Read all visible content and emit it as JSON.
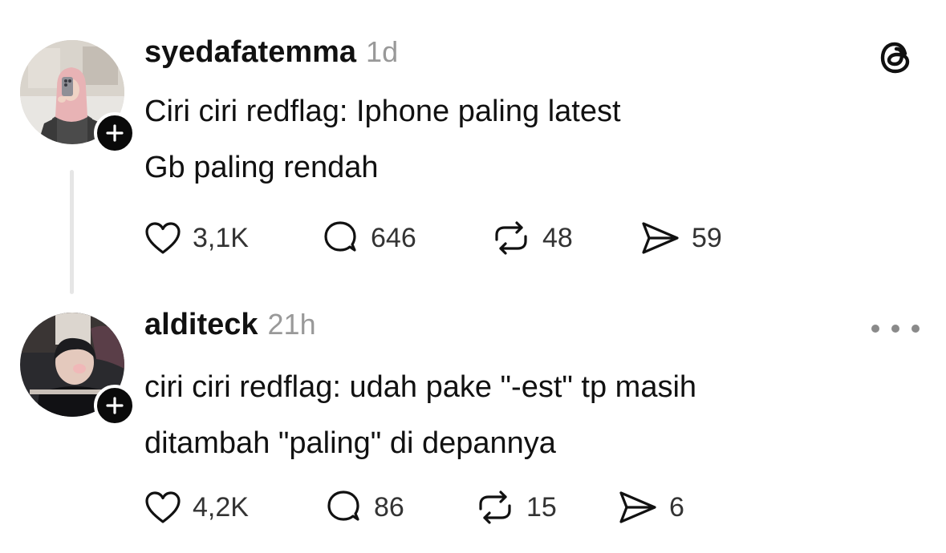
{
  "posts": [
    {
      "username": "syedafatemma",
      "timestamp": "1d",
      "lines": [
        "Ciri ciri redflag: Iphone paling latest",
        "Gb paling rendah"
      ],
      "likes": "3,1K",
      "comments": "646",
      "reposts": "48",
      "shares": "59"
    },
    {
      "username": "alditeck",
      "timestamp": "21h",
      "lines": [
        "ciri ciri redflag: udah pake \"-est\" tp masih",
        "ditambah \"paling\" di depannya"
      ],
      "likes": "4,2K",
      "comments": "86",
      "reposts": "15",
      "shares": "6"
    }
  ],
  "icons": {
    "follow": "plus-icon",
    "like": "heart-icon",
    "comment": "comment-bubble-icon",
    "repost": "repost-icon",
    "share": "send-icon",
    "app": "threads-logo-icon",
    "more": "more-options-icon"
  },
  "colors": {
    "text": "#111111",
    "muted": "#999999",
    "badge": "#0a0a0a",
    "thread_line": "#e6e6e6"
  }
}
